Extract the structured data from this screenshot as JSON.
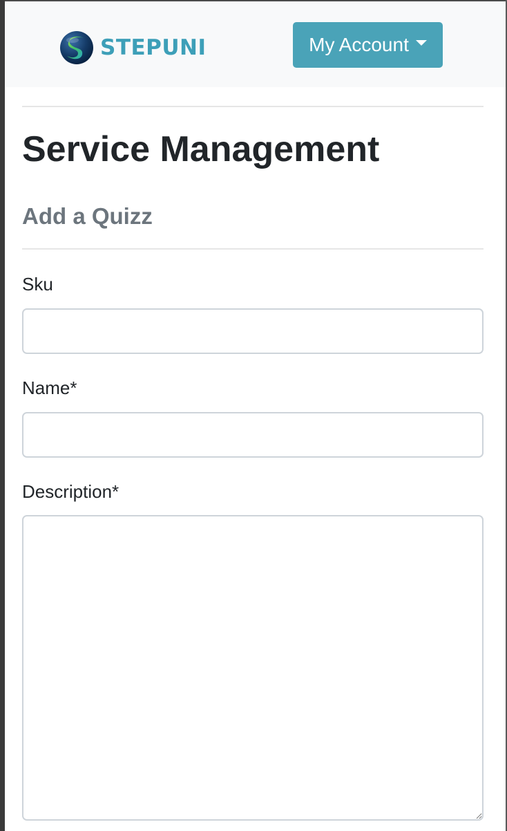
{
  "navbar": {
    "brand_name": "STEPUNI",
    "logo_icon": "stepuni-globe-logo",
    "account_button_label": "My Account",
    "account_caret_icon": "caret-down-icon"
  },
  "page": {
    "title": "Service Management",
    "subtitle": "Add a Quizz"
  },
  "form": {
    "sku": {
      "label": "Sku",
      "value": "",
      "placeholder": ""
    },
    "name": {
      "label": "Name*",
      "value": "",
      "placeholder": ""
    },
    "description": {
      "label": "Description*",
      "value": "",
      "placeholder": ""
    }
  },
  "colors": {
    "brand": "#3d9fb8",
    "account_button": "#4aa3b8",
    "navbar_bg": "#f8f9fa",
    "subtitle": "#6c757d"
  }
}
